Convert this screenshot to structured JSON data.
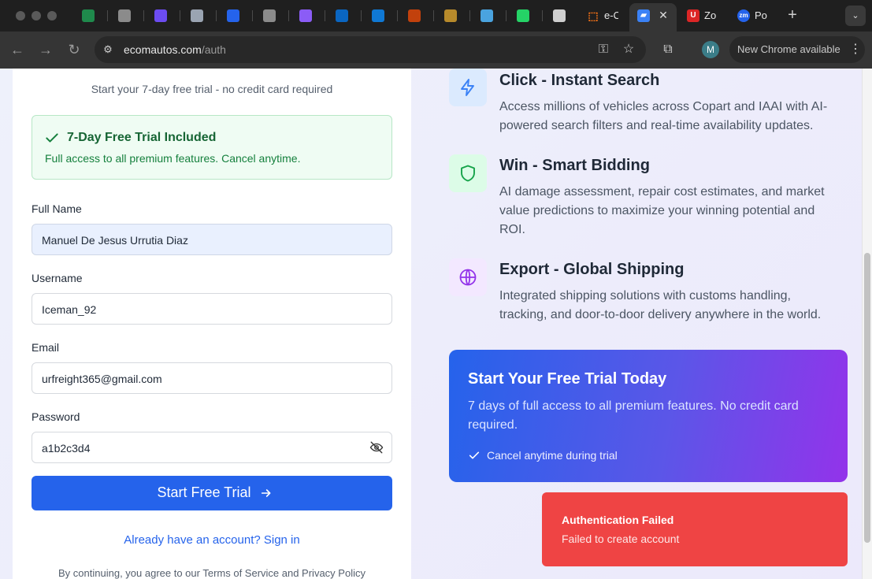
{
  "browser": {
    "tabs": [
      {
        "icon": "shield-icon",
        "color": "#1f8a4c"
      },
      {
        "icon": "document-icon",
        "color": "#8b8b8b"
      },
      {
        "icon": "s-logo-icon",
        "color": "#6c4cf1"
      },
      {
        "icon": "gear-icon",
        "color": "#9aa4b2"
      },
      {
        "icon": "spiral-icon",
        "color": "#2563eb"
      },
      {
        "icon": "globe-icon",
        "color": "#8b8b8b"
      },
      {
        "icon": "m-logo-icon",
        "color": "#8b5cf6"
      },
      {
        "icon": "linkedin-icon",
        "color": "#0a66c2"
      },
      {
        "icon": "outlook-icon",
        "color": "#0f78d4"
      },
      {
        "icon": "car-icon",
        "color": "#c2410c"
      },
      {
        "icon": "bank-icon",
        "color": "#b78a2b"
      },
      {
        "icon": "robot-icon",
        "color": "#4aa3df"
      },
      {
        "icon": "whatsapp-icon",
        "color": "#25d366"
      },
      {
        "icon": "openai-icon",
        "color": "#cfcfcf"
      }
    ],
    "tab_ecom": "e-C",
    "tab_zoho": "Zo",
    "tab_zoom": "Po",
    "url_host": "ecomautos.com",
    "url_path": "/auth",
    "profile_initial": "M",
    "update_label": "New Chrome available"
  },
  "form": {
    "subtitle": "Start your 7-day free trial - no credit card required",
    "trial_title": "7-Day Free Trial Included",
    "trial_desc": "Full access to all premium features. Cancel anytime.",
    "full_name_label": "Full Name",
    "full_name_value": "Manuel De Jesus Urrutia Diaz",
    "username_label": "Username",
    "username_value": "Iceman_92",
    "email_label": "Email",
    "email_value": "urfreight365@gmail.com",
    "password_label": "Password",
    "password_value": "a1b2c3d4",
    "submit_label": "Start Free Trial",
    "signin_link": "Already have an account? Sign in",
    "terms": "By continuing, you agree to our Terms of Service and Privacy Policy"
  },
  "features": [
    {
      "title": "Click - Instant Search",
      "desc": "Access millions of vehicles across Copart and IAAI with AI-powered search filters and real-time availability updates.",
      "icon": "lightning-icon",
      "color": "#3b82f6"
    },
    {
      "title": "Win - Smart Bidding",
      "desc": "AI damage assessment, repair cost estimates, and market value predictions to maximize your winning potential and ROI.",
      "icon": "shield-icon",
      "color": "#16a34a"
    },
    {
      "title": "Export - Global Shipping",
      "desc": "Integrated shipping solutions with customs handling, tracking, and door-to-door delivery anywhere in the world.",
      "icon": "globe-icon",
      "color": "#9333ea"
    }
  ],
  "promo": {
    "title": "Start Your Free Trial Today",
    "desc": "7 days of full access to all premium features. No credit card required.",
    "note": "Cancel anytime during trial"
  },
  "toast": {
    "title": "Authentication Failed",
    "desc": "Failed to create account"
  }
}
